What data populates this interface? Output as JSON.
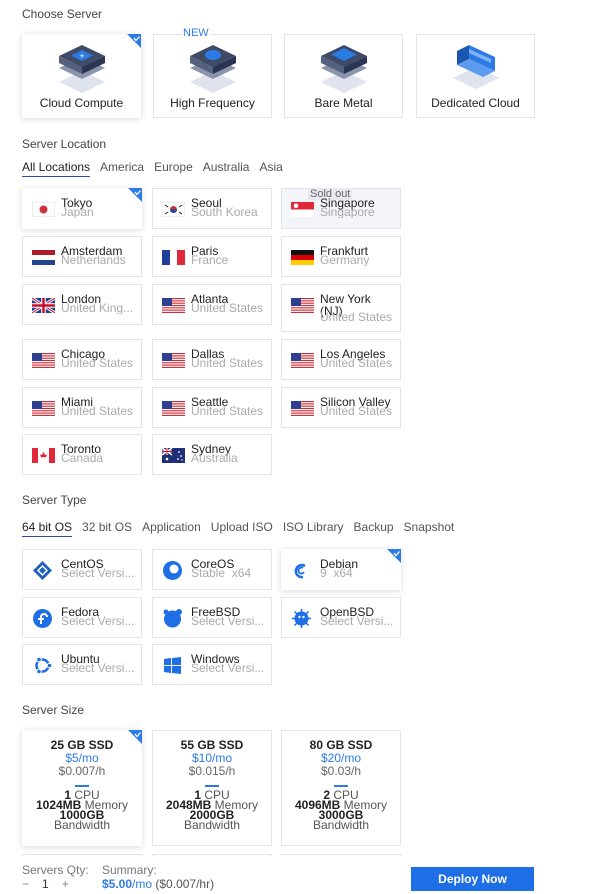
{
  "sections": {
    "choose_server": "Choose Server",
    "server_location": "Server Location",
    "server_type": "Server Type",
    "server_size": "Server Size"
  },
  "server_types": [
    {
      "label": "Cloud Compute",
      "selected": true
    },
    {
      "label": "High Frequency",
      "badge": "NEW"
    },
    {
      "label": "Bare Metal"
    },
    {
      "label": "Dedicated Cloud"
    }
  ],
  "location_tabs": [
    "All Locations",
    "America",
    "Europe",
    "Australia",
    "Asia"
  ],
  "locations": [
    {
      "city": "Tokyo",
      "country": "Japan",
      "flag": "japan-flag",
      "selected": true
    },
    {
      "city": "Seoul",
      "country": "South Korea",
      "flag": "south-korea-flag"
    },
    {
      "city": "Singapore",
      "country": "Singapore",
      "flag": "singapore-flag",
      "tag": "Sold out"
    },
    {
      "city": "Amsterdam",
      "country": "Netherlands",
      "flag": "netherlands-flag"
    },
    {
      "city": "Paris",
      "country": "France",
      "flag": "france-flag"
    },
    {
      "city": "Frankfurt",
      "country": "Germany",
      "flag": "germany-flag"
    },
    {
      "city": "London",
      "country": "United King...",
      "flag": "uk-flag"
    },
    {
      "city": "Atlanta",
      "country": "United States",
      "flag": "us-flag"
    },
    {
      "city": "New York (NJ)",
      "country": "United States",
      "flag": "us-flag"
    },
    {
      "city": "Chicago",
      "country": "United States",
      "flag": "us-flag"
    },
    {
      "city": "Dallas",
      "country": "United States",
      "flag": "us-flag"
    },
    {
      "city": "Los Angeles",
      "country": "United States",
      "flag": "us-flag"
    },
    {
      "city": "Miami",
      "country": "United States",
      "flag": "us-flag"
    },
    {
      "city": "Seattle",
      "country": "United States",
      "flag": "us-flag"
    },
    {
      "city": "Silicon Valley",
      "country": "United States",
      "flag": "us-flag"
    },
    {
      "city": "Toronto",
      "country": "Canada",
      "flag": "canada-flag"
    },
    {
      "city": "Sydney",
      "country": "Australia",
      "flag": "australia-flag"
    }
  ],
  "type_tabs": [
    "64 bit OS",
    "32 bit OS",
    "Application",
    "Upload ISO",
    "ISO Library",
    "Backup",
    "Snapshot"
  ],
  "os_list": [
    {
      "name": "CentOS",
      "version": "Select Versi...",
      "icon": "centos-icon"
    },
    {
      "name": "CoreOS",
      "version": "Stable  x64",
      "icon": "coreos-icon"
    },
    {
      "name": "Debian",
      "version": "9  x64",
      "icon": "debian-icon",
      "selected": true
    },
    {
      "name": "Fedora",
      "version": "Select Versi...",
      "icon": "fedora-icon"
    },
    {
      "name": "FreeBSD",
      "version": "Select Versi...",
      "icon": "freebsd-icon"
    },
    {
      "name": "OpenBSD",
      "version": "Select Versi...",
      "icon": "openbsd-icon"
    },
    {
      "name": "Ubuntu",
      "version": "Select Versi...",
      "icon": "ubuntu-icon"
    },
    {
      "name": "Windows",
      "version": "Select Versi...",
      "icon": "windows-icon"
    }
  ],
  "sizes": [
    {
      "ssd": "25 GB SSD",
      "price": "$5",
      "per": "/mo",
      "hourly": "$0.007/h",
      "cpu": "1",
      "cpu_label": "CPU",
      "memory": "1024MB",
      "memory_label": "Memory",
      "bandwidth": "1000GB",
      "bandwidth_label": "Bandwidth",
      "selected": true
    },
    {
      "ssd": "55 GB SSD",
      "price": "$10",
      "per": "/mo",
      "hourly": "$0.015/h",
      "cpu": "1",
      "cpu_label": "CPU",
      "memory": "2048MB",
      "memory_label": "Memory",
      "bandwidth": "2000GB",
      "bandwidth_label": "Bandwidth"
    },
    {
      "ssd": "80 GB SSD",
      "price": "$20",
      "per": "/mo",
      "hourly": "$0.03/h",
      "cpu": "2",
      "cpu_label": "CPU",
      "memory": "4096MB",
      "memory_label": "Memory",
      "bandwidth": "3000GB",
      "bandwidth_label": "Bandwidth"
    }
  ],
  "footer": {
    "qty_label": "Servers Qty:",
    "minus": "−",
    "qty": "1",
    "plus": "+",
    "summary_label": "Summary:",
    "summary_amount": "$5.00",
    "summary_per": "/mo",
    "summary_hourly": "($0.007/hr)",
    "deploy": "Deploy Now"
  },
  "colors": {
    "accent": "#1e6ee6",
    "link": "#2c7be5"
  }
}
